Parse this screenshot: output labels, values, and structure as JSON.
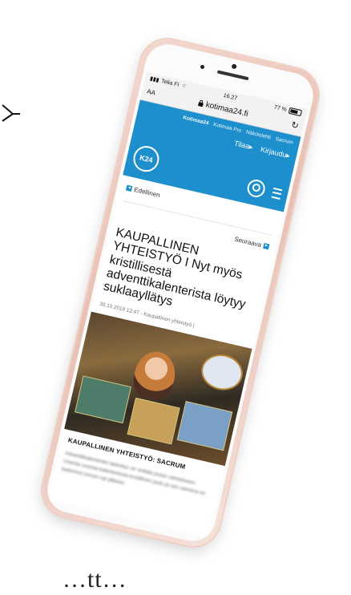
{
  "status_bar": {
    "carrier": "Telia FI",
    "time": "16.27",
    "battery": "77 %"
  },
  "address_bar": {
    "text_size_label": "AA",
    "url": "kotimaa24.fi",
    "reload_icon": "reload-icon"
  },
  "site_header": {
    "top_nav": [
      "Kotimaa24",
      "Kotimaa Pro",
      "Näköislehti",
      "Sacrum"
    ],
    "account_nav": [
      "Tilaa▸",
      "Kirjaudu▸"
    ],
    "logo_text": "K24",
    "brand_color": "#1d8fcd"
  },
  "article_nav": {
    "previous": "Edellinen",
    "next": "Seuraava"
  },
  "article": {
    "headline": "KAUPALLINEN YHTEISTYÖ I Nyt myös kristillisestä adventtikalenterista löytyy suklaayllätys",
    "meta": "30.10.2019 12:47 - Kaupallinen yhteistyö |",
    "caption_title": "KAUPALLINEN YHTEISTYÖ: SACRUM",
    "body_blurred": "Adventtikalenterien tarkoitus on virittää joulun odotukseen. Useista uusista kalentereista kristillinen joulu ja sen sanoma on kadonnut sivuun nyt jälkeen."
  },
  "bottom_text": "…tt…"
}
